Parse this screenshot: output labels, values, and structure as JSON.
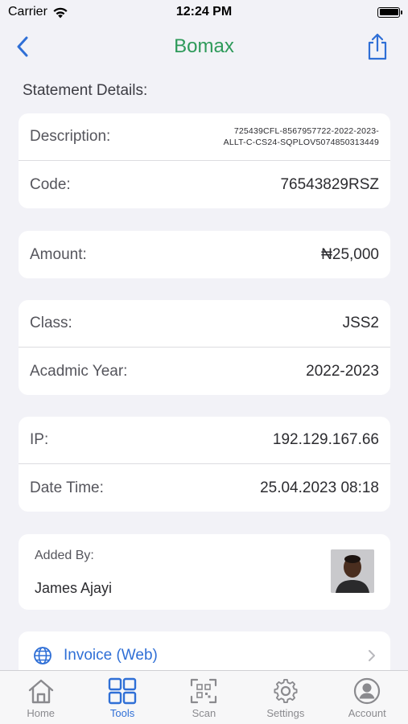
{
  "status": {
    "carrier": "Carrier",
    "time": "12:24 PM"
  },
  "nav": {
    "title": "Bomax"
  },
  "section": {
    "title": "Statement Details:"
  },
  "details": {
    "description_label": "Description:",
    "description_line1": "725439CFL-8567957722-2022-2023-",
    "description_line2": "ALLT-C-CS24-SQPLOV5074850313449",
    "code_label": "Code:",
    "code_value": "76543829RSZ",
    "amount_label": "Amount:",
    "amount_value": "₦25,000",
    "class_label": "Class:",
    "class_value": "JSS2",
    "year_label": "Acadmic Year:",
    "year_value": "2022-2023",
    "ip_label": "IP:",
    "ip_value": "192.129.167.66",
    "datetime_label": "Date Time:",
    "datetime_value": "25.04.2023 08:18"
  },
  "added_by": {
    "label": "Added By:",
    "name": "James Ajayi"
  },
  "invoice": {
    "label": "Invoice (Web)",
    "icon": "globe-icon"
  },
  "tabs": [
    {
      "label": "Home",
      "icon": "house-icon",
      "active": false
    },
    {
      "label": "Tools",
      "icon": "grid-icon",
      "active": true
    },
    {
      "label": "Scan",
      "icon": "qr-scan-icon",
      "active": false
    },
    {
      "label": "Settings",
      "icon": "gear-icon",
      "active": false
    },
    {
      "label": "Account",
      "icon": "person-circle-icon",
      "active": false
    }
  ],
  "colors": {
    "accent": "#2f6fd6",
    "title_green": "#2e9a5a",
    "background": "#f2f2f7",
    "inactive": "#8a8a8e"
  }
}
